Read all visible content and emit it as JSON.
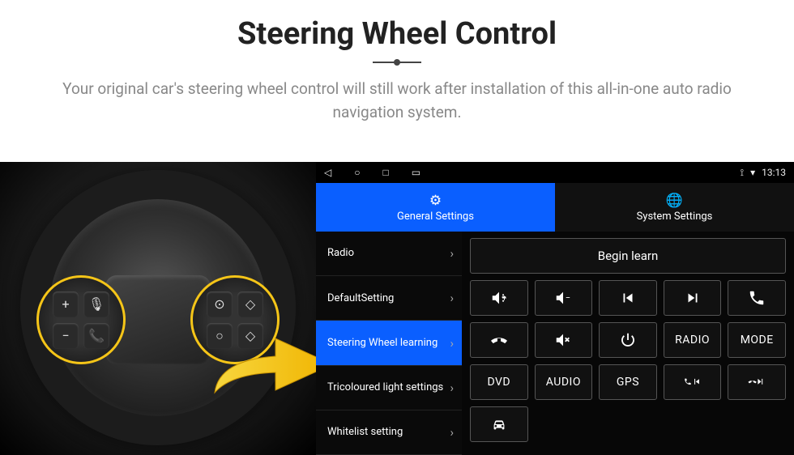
{
  "header": {
    "title": "Steering Wheel Control",
    "subtitle": "Your original car's steering wheel control will still work after installation of this all-in-one auto radio navigation system."
  },
  "statusbar": {
    "time": "13:13"
  },
  "tabs": {
    "general": "General Settings",
    "system": "System Settings"
  },
  "menu": {
    "items": [
      {
        "label": "Radio"
      },
      {
        "label": "DefaultSetting"
      },
      {
        "label": "Steering Wheel learning"
      },
      {
        "label": "Tricoloured light settings"
      },
      {
        "label": "Whitelist setting"
      }
    ],
    "active_index": 2
  },
  "panel": {
    "begin_label": "Begin learn",
    "buttons": {
      "vol_up": "vol-up-icon",
      "vol_down": "vol-down-icon",
      "prev": "prev-track-icon",
      "next": "next-track-icon",
      "call": "phone-icon",
      "hangup": "hangup-icon",
      "mute": "mute-icon",
      "power": "power-icon",
      "radio": "RADIO",
      "mode": "MODE",
      "dvd": "DVD",
      "audio": "AUDIO",
      "gps": "GPS",
      "call_prev": "call-prev-icon",
      "call_next": "call-next-icon",
      "car": "car-icon"
    }
  }
}
